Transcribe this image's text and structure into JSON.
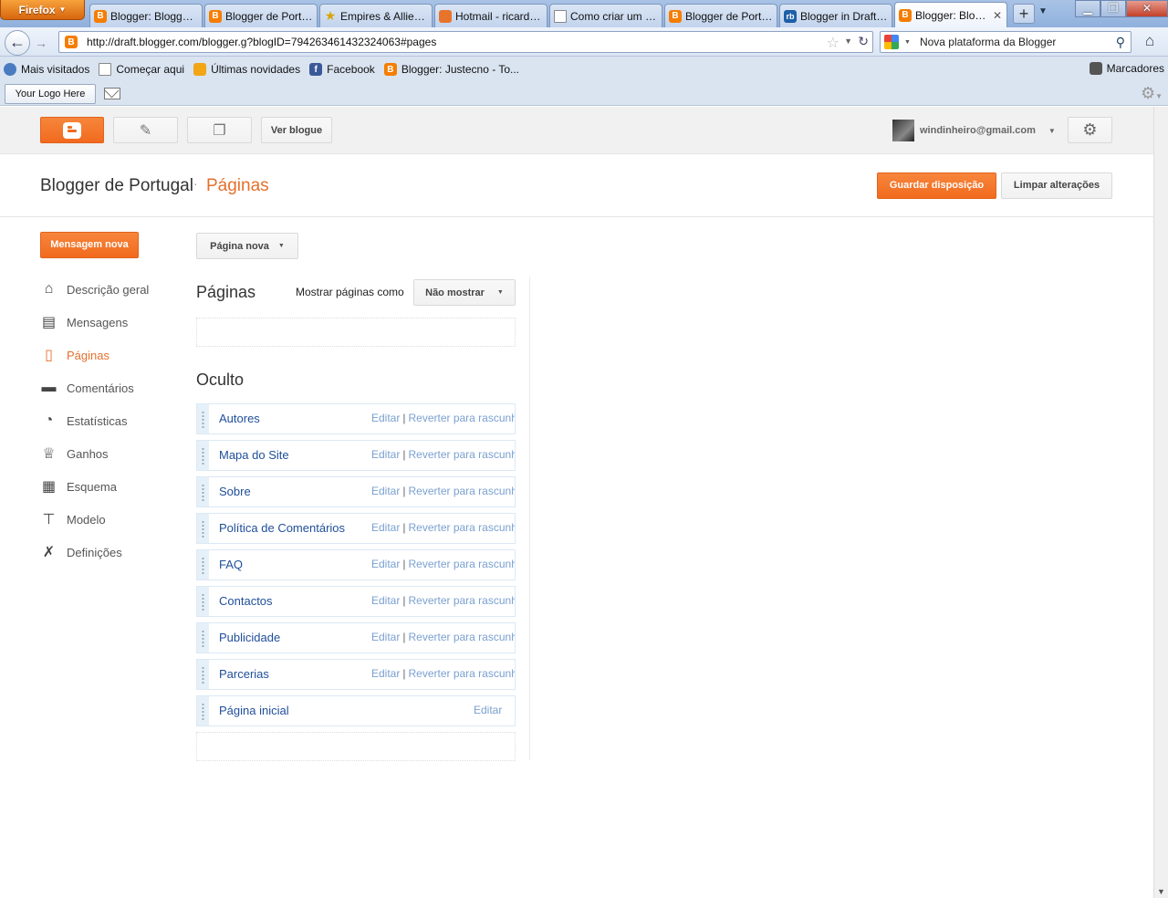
{
  "browser": {
    "app_button": "Firefox",
    "tabs": [
      {
        "label": "Blogger: Blogger...",
        "icon": "blogger"
      },
      {
        "label": "Blogger de Portu...",
        "icon": "blogger"
      },
      {
        "label": "Empires & Allies ...",
        "icon": "star"
      },
      {
        "label": "Hotmail - ricardo...",
        "icon": "hotmail"
      },
      {
        "label": "Como criar um B...",
        "icon": "doc"
      },
      {
        "label": "Blogger de Portu...",
        "icon": "blogger"
      },
      {
        "label": "Blogger in Draft ...",
        "icon": "rb"
      },
      {
        "label": "Blogger: Blog...",
        "icon": "blogger",
        "active": true
      }
    ],
    "new_tab": "+",
    "url": "http://draft.blogger.com/blogger.g?blogID=794263461432324063#pages",
    "search_value": "Nova plataforma da Blogger",
    "bookmarks": [
      {
        "label": "Mais visitados",
        "icon": "mv"
      },
      {
        "label": "Começar aqui",
        "icon": "doc"
      },
      {
        "label": "Últimas novidades",
        "icon": "rss"
      },
      {
        "label": "Facebook",
        "icon": "fb"
      },
      {
        "label": "Blogger: Justecno - To...",
        "icon": "blogger"
      }
    ],
    "bookmarks_menu": "Marcadores",
    "logo_button": "Your Logo Here"
  },
  "topbar": {
    "view_blog": "Ver blogue",
    "account_email": "windinheiro@gmail.com"
  },
  "header": {
    "blog_title": "Blogger de Portugal",
    "separator": "·",
    "section": "Páginas",
    "save_button": "Guardar disposição",
    "clear_button": "Limpar alterações"
  },
  "sidebar": {
    "new_post": "Mensagem nova",
    "items": [
      {
        "label": "Descrição geral",
        "icon": "home"
      },
      {
        "label": "Mensagens",
        "icon": "posts"
      },
      {
        "label": "Páginas",
        "icon": "pages",
        "active": true
      },
      {
        "label": "Comentários",
        "icon": "comment"
      },
      {
        "label": "Estatísticas",
        "icon": "pie"
      },
      {
        "label": "Ganhos",
        "icon": "trophy"
      },
      {
        "label": "Esquema",
        "icon": "layout"
      },
      {
        "label": "Modelo",
        "icon": "paint-roller"
      },
      {
        "label": "Definições",
        "icon": "wrench"
      }
    ]
  },
  "main": {
    "new_page": "Página nova",
    "pages_heading": "Páginas",
    "show_as_label": "Mostrar páginas como",
    "show_as_value": "Não mostrar",
    "hidden_heading": "Oculto",
    "edit_label": "Editar",
    "revert_label": "Reverter para rascunh",
    "action_separator": "|",
    "hidden_pages": [
      {
        "title": "Autores",
        "revert": true
      },
      {
        "title": "Mapa do Site",
        "revert": true
      },
      {
        "title": "Sobre",
        "revert": true
      },
      {
        "title": "Política de Comentários",
        "revert": true
      },
      {
        "title": "FAQ",
        "revert": true
      },
      {
        "title": "Contactos",
        "revert": true
      },
      {
        "title": "Publicidade",
        "revert": true
      },
      {
        "title": "Parcerias",
        "revert": true
      },
      {
        "title": "Página inicial",
        "revert": false
      }
    ]
  },
  "colors": {
    "accent_orange": "#f16a1e",
    "link_blue": "#1f4e9a",
    "action_blue": "#7aa0d0"
  }
}
